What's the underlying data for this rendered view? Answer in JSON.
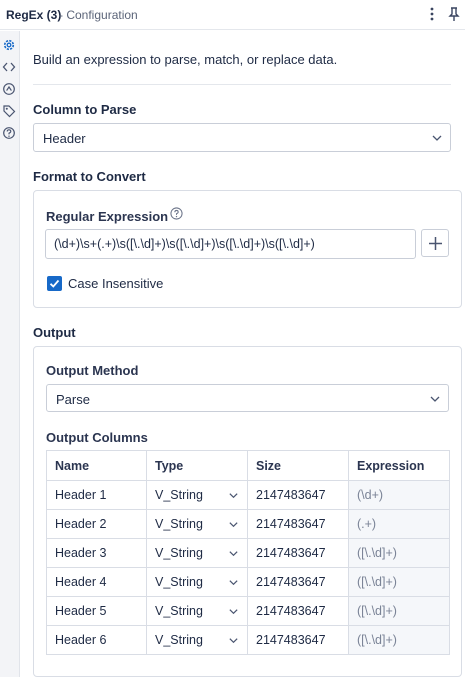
{
  "titlebar": {
    "title": "RegEx (3)",
    "subtitle": "- Configuration"
  },
  "sidebar": {
    "icons": [
      "gear-icon",
      "code-icon",
      "tool-info-icon",
      "tag-icon",
      "help-icon"
    ]
  },
  "intro": "Build an expression to parse, match, or replace data.",
  "column_to_parse": {
    "label": "Column to Parse",
    "value": "Header"
  },
  "format": {
    "label": "Format to Convert",
    "regex_label": "Regular Expression",
    "regex_value": "(\\d+)\\s+(.+)\\s([\\.\\d]+)\\s([\\.\\d]+)\\s([\\.\\d]+)\\s([\\.\\d]+)",
    "case_insensitive_label": "Case Insensitive",
    "case_insensitive_checked": true
  },
  "output": {
    "label": "Output",
    "method_label": "Output Method",
    "method_value": "Parse",
    "columns_label": "Output Columns",
    "headers": [
      "Name",
      "Type",
      "Size",
      "Expression"
    ],
    "rows": [
      {
        "name": "Header 1",
        "type": "V_String",
        "size": "2147483647",
        "expression": "(\\d+)"
      },
      {
        "name": "Header 2",
        "type": "V_String",
        "size": "2147483647",
        "expression": "(.+)"
      },
      {
        "name": "Header 3",
        "type": "V_String",
        "size": "2147483647",
        "expression": "([\\.\\d]+)"
      },
      {
        "name": "Header 4",
        "type": "V_String",
        "size": "2147483647",
        "expression": "([\\.\\d]+)"
      },
      {
        "name": "Header 5",
        "type": "V_String",
        "size": "2147483647",
        "expression": "([\\.\\d]+)"
      },
      {
        "name": "Header 6",
        "type": "V_String",
        "size": "2147483647",
        "expression": "([\\.\\d]+)"
      }
    ]
  },
  "colors": {
    "accent": "#1769c8",
    "text": "#1e2a44",
    "border": "#c9ced8"
  }
}
